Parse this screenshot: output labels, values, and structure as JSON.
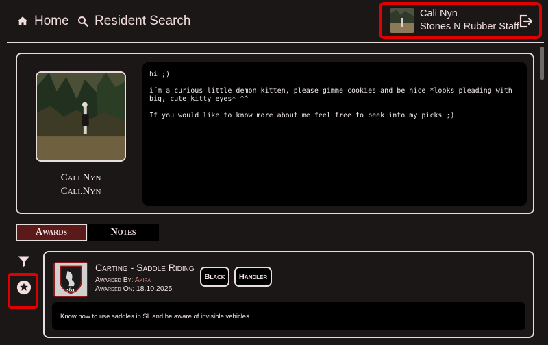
{
  "nav": {
    "home_label": "Home",
    "search_label": "Resident Search"
  },
  "user": {
    "name": "Cali Nyn",
    "role": "Stones N Rubber Staff"
  },
  "profile": {
    "display_name": "Cali Nyn",
    "username": "Cali.Nyn",
    "bio": "hi ;)\n\ni´m a curious little demon kitten, please gimme cookies and be nice *looks pleading with\nbig, cute kitty eyes* ^^\n\nIf you would like to know more about me feel free to peek into my picks ;)"
  },
  "tabs": {
    "awards_label": "Awards",
    "notes_label": "Notes"
  },
  "award": {
    "title": "Carting - Saddle Riding",
    "awarded_by_label": "Awarded By:",
    "awarded_by": "Akira",
    "awarded_on_label": "Awarded On:",
    "awarded_on": "18.10.2025",
    "tags": [
      "Black",
      "Handler"
    ],
    "logo_text": "s&r",
    "description": "Know how to use saddles in SL and be aware of invisible vehicles."
  },
  "icons": {
    "home": "home-icon",
    "search": "search-icon",
    "logout": "logout-icon",
    "filter": "filter-icon",
    "star": "star-icon"
  },
  "colors": {
    "background": "#1b1717",
    "accent_tab": "#5a1a1a",
    "highlight_red": "#e00000",
    "awarder_link": "#e28a8a"
  }
}
